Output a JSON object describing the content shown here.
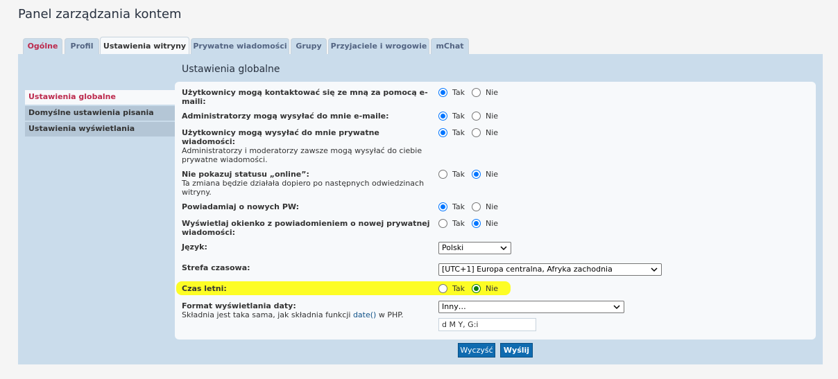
{
  "page": {
    "title": "Panel zarządzania kontem"
  },
  "tabs": [
    {
      "label": "Ogólne"
    },
    {
      "label": "Profil"
    },
    {
      "label": "Ustawienia witryny"
    },
    {
      "label": "Prywatne wiadomości"
    },
    {
      "label": "Grupy"
    },
    {
      "label": "Przyjaciele i wrogowie"
    },
    {
      "label": "mChat"
    }
  ],
  "active_tab": "Ustawienia witryny",
  "sidebar": {
    "items": [
      {
        "label": "Ustawienia globalne"
      },
      {
        "label": "Domyślne ustawienia pisania"
      },
      {
        "label": "Ustawienia wyświetlania"
      }
    ],
    "active": "Ustawienia globalne"
  },
  "section": {
    "heading": "Ustawienia globalne"
  },
  "options": {
    "yes": "Tak",
    "no": "Nie"
  },
  "settings": [
    {
      "label": "Użytkownicy mogą kontaktować się ze mną za pomocą e-maili:",
      "value": "Tak"
    },
    {
      "label": "Administratorzy mogą wysyłać do mnie e-maile:",
      "value": "Tak"
    },
    {
      "label": "Użytkownicy mogą wysyłać do mnie prywatne wiadomości:",
      "note": "Administratorzy i moderatorzy zawsze mogą wysyłać do ciebie prywatne wiadomości.",
      "value": "Tak"
    },
    {
      "label": "Nie pokazuj statusu „online”:",
      "note": "Ta zmiana będzie działała dopiero po następnych odwiedzinach witryny.",
      "value": "Nie"
    },
    {
      "label": "Powiadamiaj o nowych PW:",
      "value": "Tak"
    },
    {
      "label": "Wyświetlaj okienko z powiadomieniem o nowej prywatnej wiadomości:",
      "value": "Nie"
    }
  ],
  "language": {
    "label": "Język:",
    "value": "Polski"
  },
  "timezone": {
    "label": "Strefa czasowa:",
    "value": "[UTC+1] Europa centralna, Afryka zachodnia"
  },
  "dst": {
    "label": "Czas letni:",
    "value": "Nie",
    "highlight_color": "#fdfd25"
  },
  "date_format": {
    "label": "Format wyświetlania daty:",
    "note_before": "Składnia jest taka sama, jak składnia funkcji ",
    "note_link": "date()",
    "note_after": " w PHP.",
    "select_value": "Inny…",
    "custom_value": "d M Y, G:i"
  },
  "buttons": {
    "reset": "Wyczyść",
    "submit": "Wyślij"
  },
  "colors": {
    "accent": "#0f6bb0",
    "tab_bg": "#cadceb",
    "active_red": "#bc2a4d"
  }
}
